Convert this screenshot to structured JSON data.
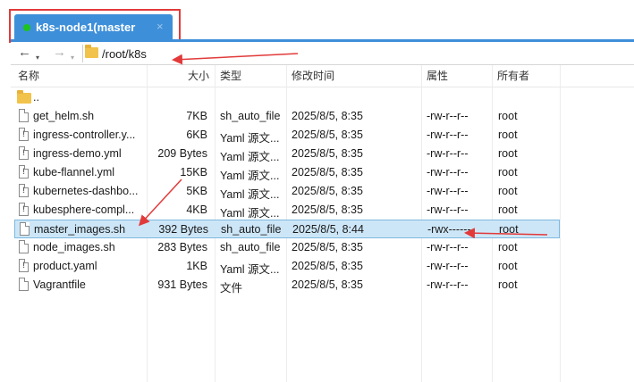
{
  "tab": {
    "title": "k8s-node1(master",
    "close": "×",
    "status_color": "#1ec41e"
  },
  "toolbar": {
    "back": "←",
    "forward": "→",
    "dropdown": "▾",
    "path": "/root/k8s"
  },
  "columns": {
    "name": "名称",
    "size": "大小",
    "type": "类型",
    "mtime": "修改时间",
    "attr": "属性",
    "owner": "所有者"
  },
  "files": [
    {
      "name": "..",
      "size": "",
      "type": "",
      "mtime": "",
      "attr": "",
      "owner": "",
      "icon": "folder-icon"
    },
    {
      "name": "get_helm.sh",
      "size": "7KB",
      "type": "sh_auto_file",
      "mtime": "2025/8/5, 8:35",
      "attr": "-rw-r--r--",
      "owner": "root",
      "icon": "file-icon"
    },
    {
      "name": "ingress-controller.y...",
      "size": "6KB",
      "type": "Yaml 源文...",
      "mtime": "2025/8/5, 8:35",
      "attr": "-rw-r--r--",
      "owner": "root",
      "icon": "yaml-file-icon"
    },
    {
      "name": "ingress-demo.yml",
      "size": "209 Bytes",
      "type": "Yaml 源文...",
      "mtime": "2025/8/5, 8:35",
      "attr": "-rw-r--r--",
      "owner": "root",
      "icon": "yaml-file-icon"
    },
    {
      "name": "kube-flannel.yml",
      "size": "15KB",
      "type": "Yaml 源文...",
      "mtime": "2025/8/5, 8:35",
      "attr": "-rw-r--r--",
      "owner": "root",
      "icon": "yaml-file-icon"
    },
    {
      "name": "kubernetes-dashbo...",
      "size": "5KB",
      "type": "Yaml 源文...",
      "mtime": "2025/8/5, 8:35",
      "attr": "-rw-r--r--",
      "owner": "root",
      "icon": "yaml-file-icon"
    },
    {
      "name": "kubesphere-compl...",
      "size": "4KB",
      "type": "Yaml 源文...",
      "mtime": "2025/8/5, 8:35",
      "attr": "-rw-r--r--",
      "owner": "root",
      "icon": "yaml-file-icon"
    },
    {
      "name": "master_images.sh",
      "size": "392 Bytes",
      "type": "sh_auto_file",
      "mtime": "2025/8/5, 8:44",
      "attr": "-rwx------",
      "owner": "root",
      "icon": "file-icon",
      "selected": true
    },
    {
      "name": "node_images.sh",
      "size": "283 Bytes",
      "type": "sh_auto_file",
      "mtime": "2025/8/5, 8:35",
      "attr": "-rw-r--r--",
      "owner": "root",
      "icon": "file-icon"
    },
    {
      "name": "product.yaml",
      "size": "1KB",
      "type": "Yaml 源文...",
      "mtime": "2025/8/5, 8:35",
      "attr": "-rw-r--r--",
      "owner": "root",
      "icon": "yaml-file-icon"
    },
    {
      "name": "Vagrantfile",
      "size": "931 Bytes",
      "type": "文件",
      "mtime": "2025/8/5, 8:35",
      "attr": "-rw-r--r--",
      "owner": "root",
      "icon": "file-icon"
    }
  ],
  "colors": {
    "tab_bg": "#3d8fd9",
    "annotation_red": "#e23a3a",
    "selection_bg": "#cde6f7"
  }
}
